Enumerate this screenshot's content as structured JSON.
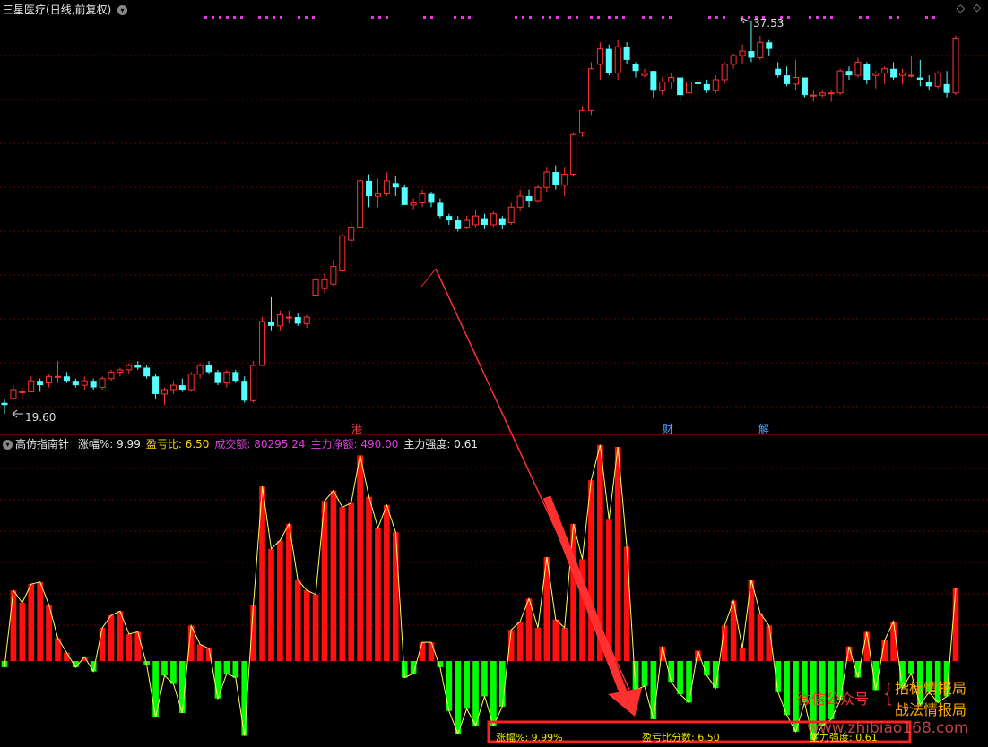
{
  "stock": {
    "name": "三星医疗",
    "period": "(日线,前复权)",
    "high_label": "37.53",
    "low_label": "19.60"
  },
  "events": [
    {
      "label": "港",
      "color": "#ff4040"
    },
    {
      "label": "财",
      "color": "#4fa3ff"
    },
    {
      "label": "解",
      "color": "#4fa3ff"
    }
  ],
  "indicator": {
    "name": "高仿指南针",
    "items": [
      {
        "label": "涨幅%:",
        "value": "9.99",
        "color": "#e6e6e6"
      },
      {
        "label": "盈亏比:",
        "value": "6.50",
        "color": "#ffd700"
      },
      {
        "label": "成交额:",
        "value": "80295.24",
        "color": "#e040e0"
      },
      {
        "label": "主力净额:",
        "value": "490.00",
        "color": "#e040e0"
      },
      {
        "label": "主力强度:",
        "value": "0.61",
        "color": "#e6e6e6"
      }
    ]
  },
  "bottom_box": {
    "rise_label": "涨幅%:",
    "rise_value": "9.99%",
    "score_label": "盈亏比分数:",
    "score_value": "6.50",
    "strength_label": "主力强度:",
    "strength_value": "0.61"
  },
  "watermark": {
    "left": "微信公众号",
    "line1": "指标情报局",
    "line2": "战法情报局",
    "site": "www.zhibiao168.com"
  },
  "colors": {
    "up": "#ff3232",
    "down": "#54ffff",
    "bar_red": "#ff1010",
    "bar_green": "#00ff00",
    "grid": "#8b0000",
    "arrow": "#ff3030"
  },
  "chart_data": {
    "type": "candlestick",
    "price_range": [
      19.6,
      37.53
    ],
    "candles": [
      [
        20.1,
        20.3,
        19.6,
        20.0
      ],
      [
        20.3,
        20.9,
        20.2,
        20.7
      ],
      [
        20.6,
        20.8,
        20.3,
        20.6
      ],
      [
        20.6,
        21.3,
        20.6,
        21.1
      ],
      [
        21.1,
        21.2,
        20.6,
        20.9
      ],
      [
        21.0,
        21.4,
        20.8,
        21.3
      ],
      [
        21.3,
        22.0,
        21.0,
        21.3
      ],
      [
        21.3,
        21.5,
        21.0,
        21.1
      ],
      [
        21.1,
        21.2,
        20.8,
        20.9
      ],
      [
        20.9,
        21.3,
        20.7,
        21.1
      ],
      [
        21.1,
        21.2,
        20.7,
        20.8
      ],
      [
        20.8,
        21.3,
        20.7,
        21.2
      ],
      [
        21.2,
        21.6,
        21.1,
        21.5
      ],
      [
        21.5,
        21.7,
        21.3,
        21.6
      ],
      [
        21.6,
        21.9,
        21.4,
        21.8
      ],
      [
        21.8,
        22.0,
        21.6,
        21.7
      ],
      [
        21.7,
        21.8,
        21.2,
        21.3
      ],
      [
        21.3,
        21.4,
        20.3,
        20.5
      ],
      [
        20.5,
        20.8,
        20.0,
        20.7
      ],
      [
        20.7,
        21.1,
        20.5,
        20.9
      ],
      [
        20.9,
        21.2,
        20.6,
        20.7
      ],
      [
        20.7,
        21.5,
        20.6,
        21.4
      ],
      [
        21.4,
        21.9,
        21.2,
        21.8
      ],
      [
        21.8,
        22.0,
        21.4,
        21.5
      ],
      [
        21.5,
        21.6,
        20.9,
        21.0
      ],
      [
        21.0,
        21.6,
        20.8,
        21.5
      ],
      [
        21.5,
        21.6,
        21.0,
        21.1
      ],
      [
        21.1,
        21.3,
        20.1,
        20.2
      ],
      [
        20.2,
        22.0,
        20.1,
        21.8
      ],
      [
        21.8,
        24.0,
        21.8,
        23.8
      ],
      [
        23.8,
        24.9,
        23.4,
        23.6
      ],
      [
        23.6,
        24.3,
        23.4,
        24.1
      ],
      [
        24.0,
        24.3,
        23.7,
        24.0
      ],
      [
        24.0,
        24.2,
        23.6,
        23.7
      ],
      [
        23.7,
        24.1,
        23.5,
        24.0
      ],
      [
        25.0,
        25.8,
        25.0,
        25.7
      ],
      [
        25.3,
        26.0,
        25.1,
        25.7
      ],
      [
        25.5,
        26.6,
        25.4,
        26.3
      ],
      [
        26.1,
        27.8,
        26.0,
        27.7
      ],
      [
        27.5,
        28.3,
        27.2,
        28.1
      ],
      [
        28.1,
        30.3,
        28.0,
        30.2
      ],
      [
        30.2,
        30.5,
        29.0,
        29.5
      ],
      [
        29.5,
        30.3,
        29.0,
        29.6
      ],
      [
        29.6,
        30.6,
        29.5,
        30.2
      ],
      [
        30.1,
        30.4,
        29.5,
        29.9
      ],
      [
        29.9,
        30.0,
        29.1,
        29.1
      ],
      [
        29.1,
        29.4,
        28.9,
        29.2
      ],
      [
        29.2,
        29.8,
        29.0,
        29.6
      ],
      [
        29.6,
        29.7,
        29.0,
        29.2
      ],
      [
        29.2,
        29.4,
        28.5,
        28.6
      ],
      [
        28.6,
        28.7,
        28.2,
        28.4
      ],
      [
        28.4,
        28.6,
        27.9,
        28.0
      ],
      [
        28.1,
        28.6,
        28.0,
        28.4
      ],
      [
        28.2,
        28.9,
        28.1,
        28.6
      ],
      [
        28.5,
        28.7,
        28.0,
        28.2
      ],
      [
        28.2,
        28.8,
        28.1,
        28.7
      ],
      [
        28.5,
        28.6,
        28.0,
        28.2
      ],
      [
        28.3,
        29.2,
        28.2,
        29.0
      ],
      [
        29.0,
        29.8,
        28.8,
        29.5
      ],
      [
        29.5,
        29.8,
        29.0,
        29.3
      ],
      [
        29.3,
        30.0,
        29.2,
        29.9
      ],
      [
        29.9,
        30.8,
        29.7,
        30.6
      ],
      [
        30.6,
        30.9,
        29.8,
        30.0
      ],
      [
        30.0,
        30.8,
        29.5,
        30.5
      ],
      [
        30.5,
        32.4,
        30.4,
        32.3
      ],
      [
        32.4,
        33.6,
        32.2,
        33.4
      ],
      [
        33.4,
        35.6,
        33.2,
        35.3
      ],
      [
        35.5,
        36.5,
        34.8,
        36.2
      ],
      [
        36.2,
        36.4,
        35.0,
        35.1
      ],
      [
        35.1,
        36.6,
        34.8,
        36.3
      ],
      [
        36.3,
        36.5,
        35.5,
        35.7
      ],
      [
        35.5,
        35.6,
        34.9,
        35.2
      ],
      [
        35.0,
        35.3,
        34.9,
        35.1
      ],
      [
        35.2,
        35.2,
        34.0,
        34.3
      ],
      [
        34.3,
        34.9,
        34.1,
        34.7
      ],
      [
        34.7,
        35.1,
        34.4,
        34.9
      ],
      [
        34.9,
        34.9,
        33.8,
        34.1
      ],
      [
        34.2,
        34.8,
        33.6,
        34.7
      ],
      [
        34.7,
        34.8,
        33.9,
        34.6
      ],
      [
        34.6,
        34.8,
        34.2,
        34.3
      ],
      [
        34.3,
        35.0,
        34.2,
        34.8
      ],
      [
        34.8,
        35.6,
        34.6,
        35.5
      ],
      [
        35.5,
        36.0,
        35.3,
        35.9
      ],
      [
        35.9,
        36.4,
        35.5,
        36.1
      ],
      [
        36.1,
        37.5,
        35.6,
        35.8
      ],
      [
        35.8,
        36.8,
        35.7,
        36.5
      ],
      [
        36.5,
        36.6,
        35.9,
        36.2
      ],
      [
        35.3,
        35.6,
        34.9,
        35.0
      ],
      [
        35.0,
        35.4,
        34.5,
        34.6
      ],
      [
        34.6,
        35.7,
        34.3,
        34.9
      ],
      [
        34.9,
        34.9,
        34.0,
        34.1
      ],
      [
        34.1,
        34.3,
        33.8,
        34.1
      ],
      [
        34.1,
        34.3,
        34.0,
        34.2
      ],
      [
        34.2,
        34.3,
        33.8,
        34.2
      ],
      [
        34.2,
        35.3,
        34.1,
        35.2
      ],
      [
        35.2,
        35.4,
        34.8,
        35.0
      ],
      [
        35.0,
        35.8,
        34.9,
        35.6
      ],
      [
        35.5,
        35.6,
        34.6,
        34.8
      ],
      [
        35.0,
        35.2,
        34.4,
        35.1
      ],
      [
        35.1,
        35.4,
        34.6,
        35.3
      ],
      [
        35.3,
        35.6,
        34.8,
        34.9
      ],
      [
        35.0,
        35.3,
        34.6,
        35.1
      ],
      [
        35.0,
        35.9,
        34.9,
        35.0
      ],
      [
        34.9,
        35.7,
        34.5,
        34.8
      ],
      [
        34.7,
        35.0,
        34.3,
        34.5
      ],
      [
        34.5,
        35.2,
        34.4,
        35.1
      ],
      [
        34.6,
        35.2,
        34.0,
        34.2
      ],
      [
        34.2,
        36.8,
        34.1,
        36.7
      ]
    ],
    "indicator_values": [
      -0.3,
      3.4,
      2.8,
      3.7,
      3.8,
      2.7,
      1.1,
      0.4,
      -0.3,
      0.2,
      -0.5,
      1.6,
      2.2,
      2.4,
      1.3,
      1.4,
      -0.2,
      -2.7,
      -0.7,
      -1.1,
      -2.5,
      1.7,
      0.8,
      0.6,
      -1.8,
      -0.6,
      -0.8,
      -3.6,
      2.7,
      8.4,
      5.4,
      5.8,
      6.6,
      3.9,
      3.4,
      3.2,
      7.7,
      8.2,
      7.4,
      7.6,
      9.9,
      7.9,
      6.4,
      7.5,
      6.2,
      -0.8,
      -0.6,
      0.9,
      0.9,
      -0.3,
      -2.4,
      -3.5,
      -2.3,
      -3.1,
      -1.7,
      -3.1,
      -2.2,
      1.5,
      1.9,
      3.0,
      1.6,
      5.0,
      2.0,
      1.6,
      6.6,
      4.9,
      8.7,
      10.4,
      6.8,
      10.3,
      5.5,
      -1.4,
      -1.2,
      -2.8,
      0.7,
      -1.0,
      -1.6,
      -2.0,
      0.5,
      -0.7,
      -1.3,
      1.7,
      2.9,
      0.6,
      3.9,
      2.3,
      1.7,
      -1.5,
      -2.6,
      -3.4,
      -2.0,
      -3.8,
      -3.1,
      -2.8,
      -1.9,
      0.7,
      -0.8,
      1.4,
      -1.4,
      1.0,
      1.9,
      -1.3,
      -0.6,
      -2.1,
      -1.5,
      -2.0,
      -1.7,
      3.5
    ]
  }
}
